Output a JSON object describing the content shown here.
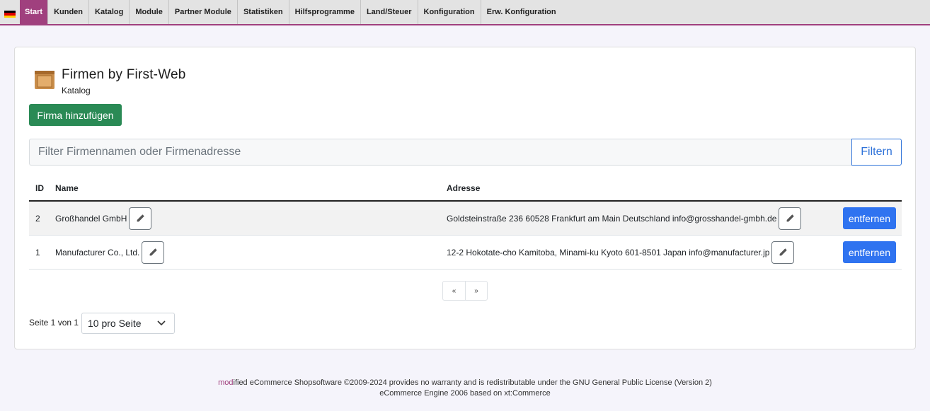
{
  "nav": {
    "items": [
      {
        "label": "Start",
        "active": true
      },
      {
        "label": "Kunden"
      },
      {
        "label": "Katalog"
      },
      {
        "label": "Module"
      },
      {
        "label": "Partner Module"
      },
      {
        "label": "Statistiken"
      },
      {
        "label": "Hilfsprogramme"
      },
      {
        "label": "Land/Steuer"
      },
      {
        "label": "Konfiguration"
      },
      {
        "label": "Erw. Konfiguration"
      }
    ],
    "accent_color": "#a0407e",
    "language_icon": "flag-de-icon"
  },
  "page": {
    "title": "Firmen by First-Web",
    "subtitle": "Katalog",
    "icon": "box-icon"
  },
  "actions": {
    "add_label": "Firma hinzufügen"
  },
  "filter": {
    "placeholder": "Filter Firmennamen oder Firmenadresse",
    "button_label": "Filtern"
  },
  "table": {
    "headers": {
      "id": "ID",
      "name": "Name",
      "address": "Adresse"
    },
    "rows": [
      {
        "id": "2",
        "name": "Großhandel GmbH",
        "address": "Goldsteinstraße 236 60528 Frankfurt am Main Deutschland info@grosshandel-gmbh.de",
        "remove_label": "entfernen"
      },
      {
        "id": "1",
        "name": "Manufacturer Co., Ltd.",
        "address": "12-2 Hokotate-cho Kamitoba, Minami-ku Kyoto 601-8501 Japan info@manufacturer.jp",
        "remove_label": "entfernen"
      }
    ]
  },
  "pagination": {
    "prev": "«",
    "next": "»",
    "info": "Seite 1 von 1",
    "per_page": "10 pro Seite"
  },
  "footer": {
    "mod": "mod",
    "line1_rest": "ified eCommerce Shopsoftware ©2009-2024 provides no warranty and is redistributable under the GNU General Public License (Version 2)",
    "line2": "eCommerce Engine 2006 based on xt:Commerce"
  }
}
